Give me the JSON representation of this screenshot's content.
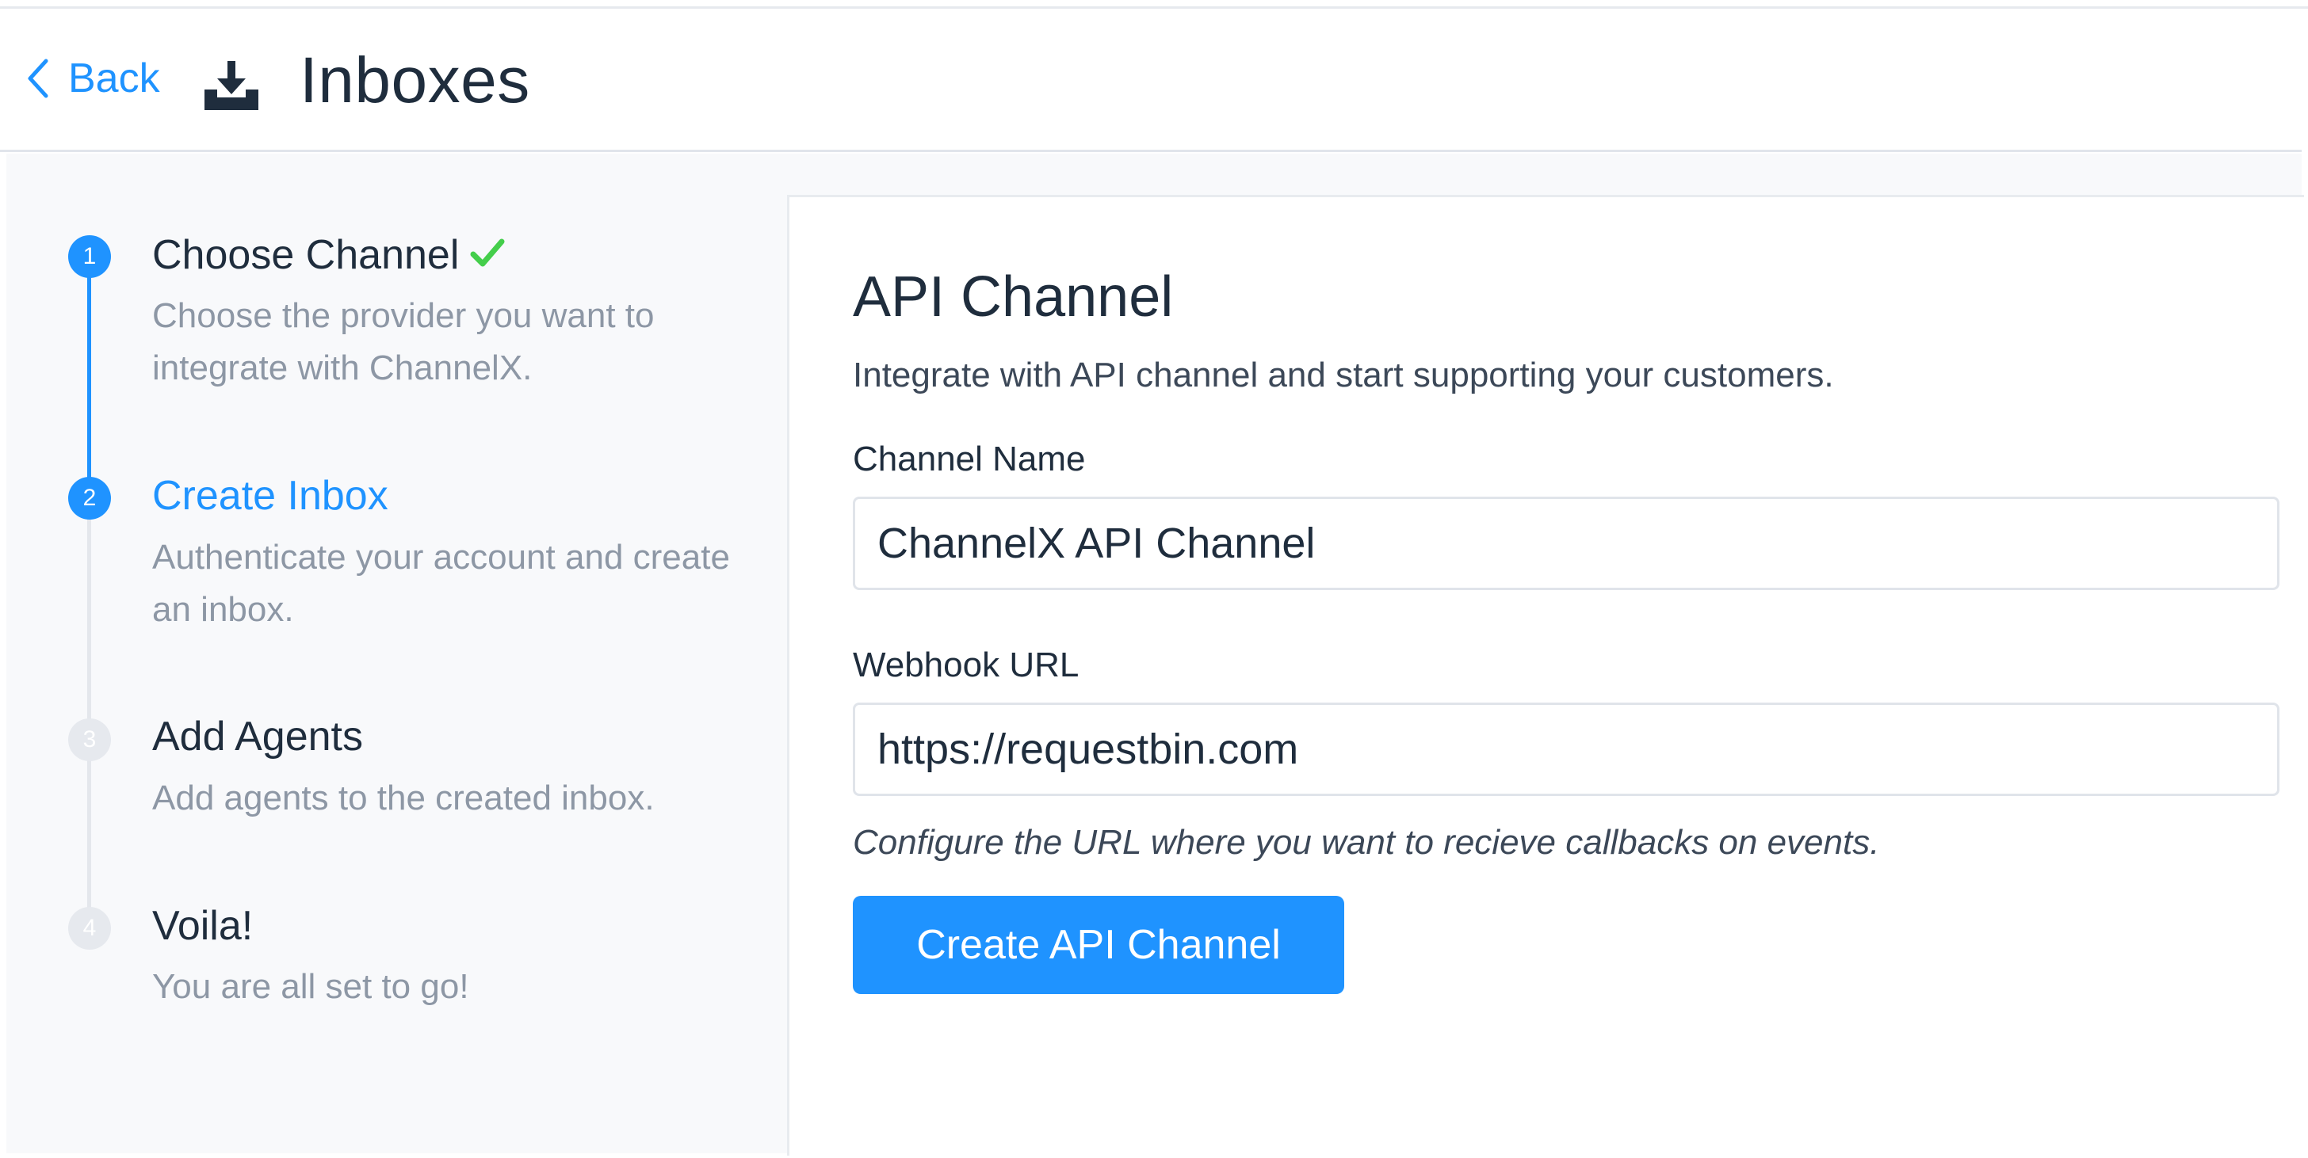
{
  "header": {
    "back_label": "Back",
    "title": "Inboxes",
    "icon": "inbox-download-icon"
  },
  "wizard": {
    "steps": [
      {
        "number": "1",
        "title": "Choose Channel",
        "description": "Choose the provider you want to integrate with ChannelX.",
        "status": "completed"
      },
      {
        "number": "2",
        "title": "Create Inbox",
        "description": "Authenticate your account and create an inbox.",
        "status": "current"
      },
      {
        "number": "3",
        "title": "Add Agents",
        "description": "Add agents to the created inbox.",
        "status": "upcoming"
      },
      {
        "number": "4",
        "title": "Voila!",
        "description": "You are all set to go!",
        "status": "upcoming"
      }
    ]
  },
  "form": {
    "title": "API Channel",
    "description": "Integrate with API channel and start supporting your customers.",
    "channel_name_label": "Channel Name",
    "channel_name_value": "ChannelX API Channel",
    "webhook_label": "Webhook URL",
    "webhook_value": "https://requestbin.com",
    "webhook_help": "Configure the URL where you want to recieve callbacks on events.",
    "submit_label": "Create API Channel"
  },
  "colors": {
    "accent": "#1f93ff",
    "success": "#44ce4b",
    "muted_text": "#8d97a5",
    "inactive_step": "#e6e9ee"
  }
}
